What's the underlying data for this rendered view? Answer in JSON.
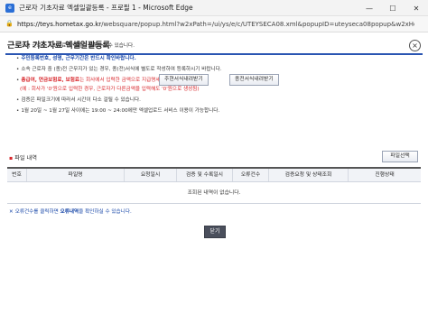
{
  "window": {
    "title": "근로자 기초자료 엑셀일괄등록 - 프로필 1 - Microsoft Edge",
    "url_host": "https://teys.hometax.go.kr",
    "url_path": "/websquare/popup.html?w2xPath=/ui/ys/e/c/UTEYSECA08.xml&popupID=uteyseca08popup&w2xHom...",
    "minimize": "—",
    "maximize": "☐",
    "close": "✕"
  },
  "popup": {
    "title": "근로자 기초자료 엑셀일괄등록",
    "close_symbol": "×"
  },
  "notice": {
    "line1": "소속 근로자 기초자료를 엑셀로 등록하실 수 있습니다.",
    "line2": "주민등록번호, 성명, 근무기간은 반드시 확인바랍니다.",
    "line3": "소속 근로자 중 (종)전 근무지가 있는 경우, 종(전)서식에 별도로 작성하여 등록하시기 바랍니다.",
    "line4a": "총급여, 연금보험료, 보험료",
    "line4b": "는 회사에서 입력한 금액으로 지급명세서가 생성됩니다.",
    "line5": "(예 : 회사가 '0'원으로 입력한 경우, 근로자가 다른금액을 입력해도 '0'원으로 생성됨)",
    "line6": "검증은 파일크기에 따라서 시간이 다소 걸릴 수 있습니다.",
    "line7": "1월 20일 ~ 1월 27일 사이에는 19:00 ~ 24:00에만 엑셀업로드 서비스 이용이 가능합니다."
  },
  "buttons": {
    "main_form_download": "주현서식내려받기",
    "prev_form_download": "종전서식내려받기",
    "file_select": "파일선택",
    "close": "닫기"
  },
  "file_section": {
    "title": "파일 내역"
  },
  "grid": {
    "columns": [
      "번호",
      "파일명",
      "요청일시",
      "검증 및 수록일시",
      "오류건수",
      "검증요청 및 상태조회",
      "진행상태"
    ],
    "empty_message": "조회된 내역이 없습니다."
  },
  "footnote": {
    "text1": "오류건수를 클릭하면",
    "text2": "오류내역",
    "text3": "을 확인하실 수 있습니다."
  }
}
